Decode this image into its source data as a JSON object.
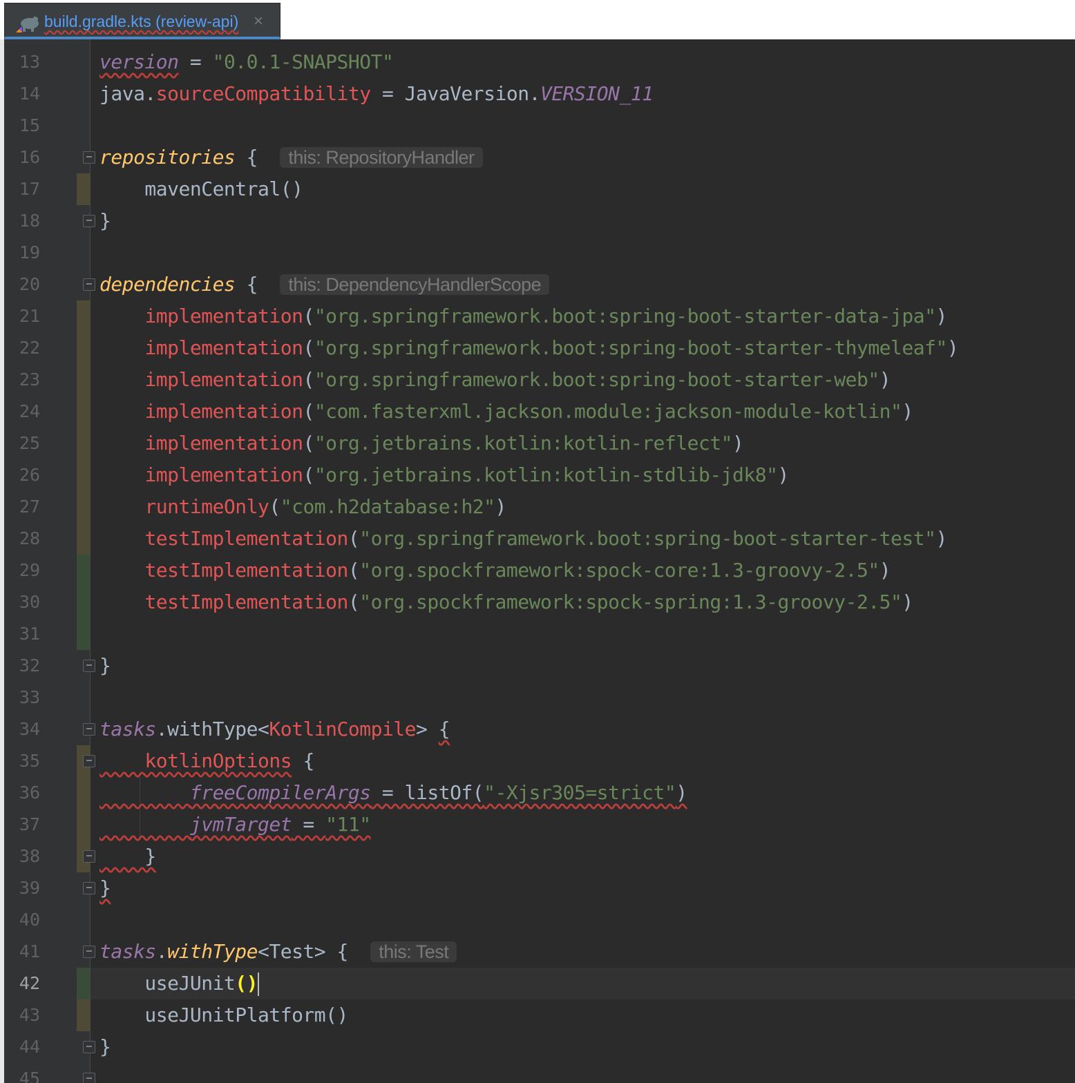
{
  "tab": {
    "title": "build.gradle.kts (review-api)",
    "close": "×",
    "icon": "gradle-kotlin-icon"
  },
  "editor": {
    "current_line": 42,
    "lines": [
      {
        "n": "13",
        "tokens": [
          {
            "t": "version",
            "c": "pri err"
          },
          {
            "t": " = ",
            "c": "op"
          },
          {
            "t": "\"0.0.1-SNAPSHOT\"",
            "c": "str"
          }
        ]
      },
      {
        "n": "14",
        "tokens": [
          {
            "t": "java.",
            "c": "op"
          },
          {
            "t": "sourceCompatibility",
            "c": "red"
          },
          {
            "t": " = JavaVersion.",
            "c": "op"
          },
          {
            "t": "VERSION_11",
            "c": "pri"
          }
        ]
      },
      {
        "n": "15",
        "tokens": []
      },
      {
        "n": "16",
        "tokens": [
          {
            "t": "repositories",
            "c": "fn"
          },
          {
            "t": " { ",
            "c": "op"
          },
          {
            "t": "this: RepositoryHandler",
            "c": "hint"
          }
        ]
      },
      {
        "n": "17",
        "tokens": [
          {
            "t": "    mavenCentral()",
            "c": "op"
          }
        ]
      },
      {
        "n": "18",
        "tokens": [
          {
            "t": "}",
            "c": "op"
          }
        ]
      },
      {
        "n": "19",
        "tokens": []
      },
      {
        "n": "20",
        "tokens": [
          {
            "t": "dependencies",
            "c": "fn"
          },
          {
            "t": " { ",
            "c": "op"
          },
          {
            "t": "this: DependencyHandlerScope",
            "c": "hint"
          }
        ]
      },
      {
        "n": "21",
        "tokens": [
          {
            "t": "    ",
            "c": "op"
          },
          {
            "t": "implementation",
            "c": "red"
          },
          {
            "t": "(",
            "c": "op"
          },
          {
            "t": "\"org.springframework.boot:spring-boot-starter-data-jpa\"",
            "c": "str"
          },
          {
            "t": ")",
            "c": "op"
          }
        ]
      },
      {
        "n": "22",
        "tokens": [
          {
            "t": "    ",
            "c": "op"
          },
          {
            "t": "implementation",
            "c": "red"
          },
          {
            "t": "(",
            "c": "op"
          },
          {
            "t": "\"org.springframework.boot:spring-boot-starter-thymeleaf\"",
            "c": "str"
          },
          {
            "t": ")",
            "c": "op"
          }
        ]
      },
      {
        "n": "23",
        "tokens": [
          {
            "t": "    ",
            "c": "op"
          },
          {
            "t": "implementation",
            "c": "red"
          },
          {
            "t": "(",
            "c": "op"
          },
          {
            "t": "\"org.springframework.boot:spring-boot-starter-web\"",
            "c": "str"
          },
          {
            "t": ")",
            "c": "op"
          }
        ]
      },
      {
        "n": "24",
        "tokens": [
          {
            "t": "    ",
            "c": "op"
          },
          {
            "t": "implementation",
            "c": "red"
          },
          {
            "t": "(",
            "c": "op"
          },
          {
            "t": "\"com.fasterxml.jackson.module:jackson-module-kotlin\"",
            "c": "str"
          },
          {
            "t": ")",
            "c": "op"
          }
        ]
      },
      {
        "n": "25",
        "tokens": [
          {
            "t": "    ",
            "c": "op"
          },
          {
            "t": "implementation",
            "c": "red"
          },
          {
            "t": "(",
            "c": "op"
          },
          {
            "t": "\"org.jetbrains.kotlin:kotlin-reflect\"",
            "c": "str"
          },
          {
            "t": ")",
            "c": "op"
          }
        ]
      },
      {
        "n": "26",
        "tokens": [
          {
            "t": "    ",
            "c": "op"
          },
          {
            "t": "implementation",
            "c": "red"
          },
          {
            "t": "(",
            "c": "op"
          },
          {
            "t": "\"org.jetbrains.kotlin:kotlin-stdlib-jdk8\"",
            "c": "str"
          },
          {
            "t": ")",
            "c": "op"
          }
        ]
      },
      {
        "n": "27",
        "tokens": [
          {
            "t": "    ",
            "c": "op"
          },
          {
            "t": "runtimeOnly",
            "c": "red"
          },
          {
            "t": "(",
            "c": "op"
          },
          {
            "t": "\"com.h2database:h2\"",
            "c": "str"
          },
          {
            "t": ")",
            "c": "op"
          }
        ]
      },
      {
        "n": "28",
        "tokens": [
          {
            "t": "    ",
            "c": "op"
          },
          {
            "t": "testImplementation",
            "c": "red"
          },
          {
            "t": "(",
            "c": "op"
          },
          {
            "t": "\"org.springframework.boot:spring-boot-starter-test\"",
            "c": "str"
          },
          {
            "t": ")",
            "c": "op"
          }
        ]
      },
      {
        "n": "29",
        "tokens": [
          {
            "t": "    ",
            "c": "op"
          },
          {
            "t": "testImplementation",
            "c": "red"
          },
          {
            "t": "(",
            "c": "op"
          },
          {
            "t": "\"org.spockframework:spock-core:1.3-groovy-2.5\"",
            "c": "str"
          },
          {
            "t": ")",
            "c": "op"
          }
        ]
      },
      {
        "n": "30",
        "tokens": [
          {
            "t": "    ",
            "c": "op"
          },
          {
            "t": "testImplementation",
            "c": "red"
          },
          {
            "t": "(",
            "c": "op"
          },
          {
            "t": "\"org.spockframework:spock-spring:1.3-groovy-2.5\"",
            "c": "str"
          },
          {
            "t": ")",
            "c": "op"
          }
        ]
      },
      {
        "n": "31",
        "tokens": []
      },
      {
        "n": "32",
        "tokens": [
          {
            "t": "}",
            "c": "op"
          }
        ]
      },
      {
        "n": "33",
        "tokens": []
      },
      {
        "n": "34",
        "tokens": [
          {
            "t": "tasks",
            "c": "pri"
          },
          {
            "t": ".withType<",
            "c": "op"
          },
          {
            "t": "KotlinCompile",
            "c": "red"
          },
          {
            "t": "> ",
            "c": "op"
          },
          {
            "t": "{",
            "c": "op err"
          }
        ]
      },
      {
        "n": "35",
        "tokens": [
          {
            "t": "    ",
            "c": "op err"
          },
          {
            "t": "kotlinOptions",
            "c": "red err"
          },
          {
            "t": " {",
            "c": "op"
          }
        ]
      },
      {
        "n": "36",
        "tokens": [
          {
            "t": "        ",
            "c": "op err"
          },
          {
            "t": "freeCompilerArgs",
            "c": "pri err"
          },
          {
            "t": " = listOf(",
            "c": "op err"
          },
          {
            "t": "\"-Xjsr305=strict\"",
            "c": "str err"
          },
          {
            "t": ")",
            "c": "op err"
          }
        ]
      },
      {
        "n": "37",
        "tokens": [
          {
            "t": "        ",
            "c": "op err"
          },
          {
            "t": "jvmTarget",
            "c": "pri err"
          },
          {
            "t": " = ",
            "c": "op err"
          },
          {
            "t": "\"11\"",
            "c": "str err"
          }
        ]
      },
      {
        "n": "38",
        "tokens": [
          {
            "t": "    }",
            "c": "op err"
          }
        ]
      },
      {
        "n": "39",
        "tokens": [
          {
            "t": "}",
            "c": "op err"
          }
        ]
      },
      {
        "n": "40",
        "tokens": []
      },
      {
        "n": "41",
        "tokens": [
          {
            "t": "tasks",
            "c": "pri"
          },
          {
            "t": ".",
            "c": "op"
          },
          {
            "t": "withType",
            "c": "fn"
          },
          {
            "t": "<Test> { ",
            "c": "op"
          },
          {
            "t": "this: Test",
            "c": "hint"
          }
        ]
      },
      {
        "n": "42",
        "tokens": [
          {
            "t": "    useJUnit",
            "c": "op"
          },
          {
            "t": "()",
            "c": "hl"
          },
          {
            "t": "",
            "c": "caret"
          }
        ]
      },
      {
        "n": "43",
        "tokens": [
          {
            "t": "    useJUnitPlatform()",
            "c": "op"
          }
        ]
      },
      {
        "n": "44",
        "tokens": [
          {
            "t": "}",
            "c": "op"
          }
        ]
      },
      {
        "n": "45",
        "tokens": []
      }
    ]
  },
  "colors": {
    "background": "#2b2b2b",
    "gutter": "#313335",
    "keyword_orange": "#cc7832",
    "string_green": "#6a8759",
    "property_purple": "#9876aa",
    "function_yellow": "#ffc66d",
    "unresolved_red": "#e05555"
  }
}
